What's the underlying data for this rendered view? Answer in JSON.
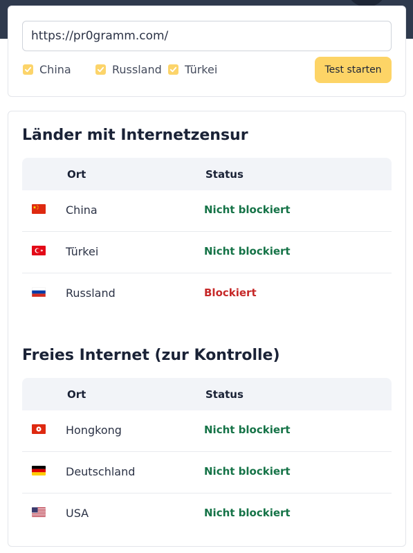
{
  "form": {
    "url_value": "https://pr0gramm.com/",
    "checkboxes": [
      {
        "label": "China",
        "checked": true
      },
      {
        "label": "Russland",
        "checked": true
      },
      {
        "label": "Türkei",
        "checked": true
      }
    ],
    "submit_label": "Test starten"
  },
  "colors": {
    "accent": "#fdd466",
    "status_ok": "#157347",
    "status_blocked": "#c62828",
    "header_bg": "#f2f4f8"
  },
  "censorship": {
    "title": "Länder mit Internetzensur",
    "columns": {
      "location": "Ort",
      "status": "Status"
    },
    "rows": [
      {
        "flag": "flag-china-icon",
        "location": "China",
        "status": "Nicht blockiert"
      },
      {
        "flag": "flag-turkey-icon",
        "location": "Türkei",
        "status": "Nicht blockiert"
      },
      {
        "flag": "flag-russia-icon",
        "location": "Russland",
        "status": "Blockiert"
      }
    ]
  },
  "control": {
    "title": "Freies Internet (zur Kontrolle)",
    "columns": {
      "location": "Ort",
      "status": "Status"
    },
    "rows": [
      {
        "flag": "flag-hongkong-icon",
        "location": "Hongkong",
        "status": "Nicht blockiert"
      },
      {
        "flag": "flag-germany-icon",
        "location": "Deutschland",
        "status": "Nicht blockiert"
      },
      {
        "flag": "flag-usa-icon",
        "location": "USA",
        "status": "Nicht blockiert"
      }
    ]
  }
}
